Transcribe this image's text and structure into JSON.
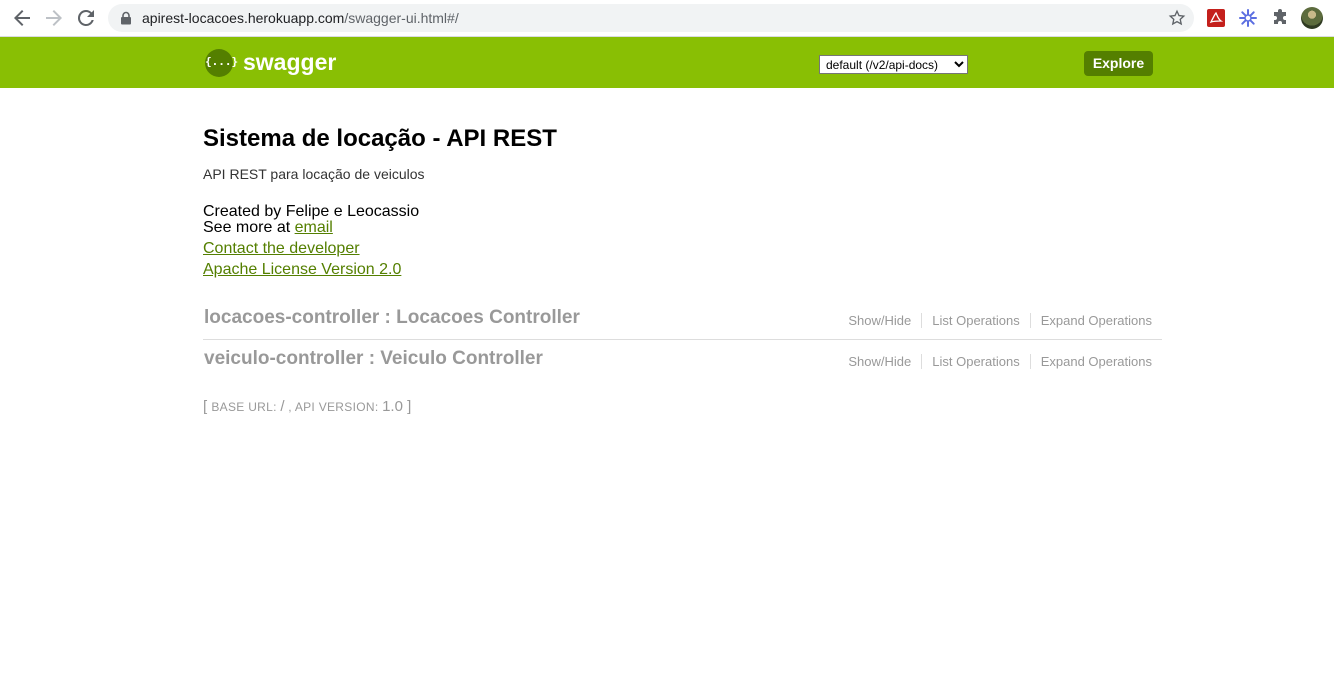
{
  "browser": {
    "url_host": "apirest-locacoes.herokuapp.com",
    "url_path": "/swagger-ui.html#/"
  },
  "header": {
    "logo_symbol": "{...}",
    "logo_text": "swagger",
    "spec_selected": "default (/v2/api-docs)",
    "explore_label": "Explore",
    "brand_color": "#89bf04",
    "dark_color": "#547f00"
  },
  "info": {
    "title": "Sistema de locação - API REST",
    "description": "API REST para locação de veiculos",
    "created_by": "Created by Felipe e Leocassio",
    "see_more_prefix": "See more at",
    "email_link": "email",
    "contact_link": "Contact the developer",
    "license_link": "Apache License Version 2.0"
  },
  "resources": [
    {
      "title": "locacoes-controller : Locacoes Controller",
      "show_hide": "Show/Hide",
      "list_ops": "List Operations",
      "expand_ops": "Expand Operations"
    },
    {
      "title": "veiculo-controller : Veiculo Controller",
      "show_hide": "Show/Hide",
      "list_ops": "List Operations",
      "expand_ops": "Expand Operations"
    }
  ],
  "footer": {
    "base_url_label": "BASE URL",
    "base_url_value": "/",
    "api_version_label": "API VERSION",
    "api_version_value": "1.0"
  }
}
